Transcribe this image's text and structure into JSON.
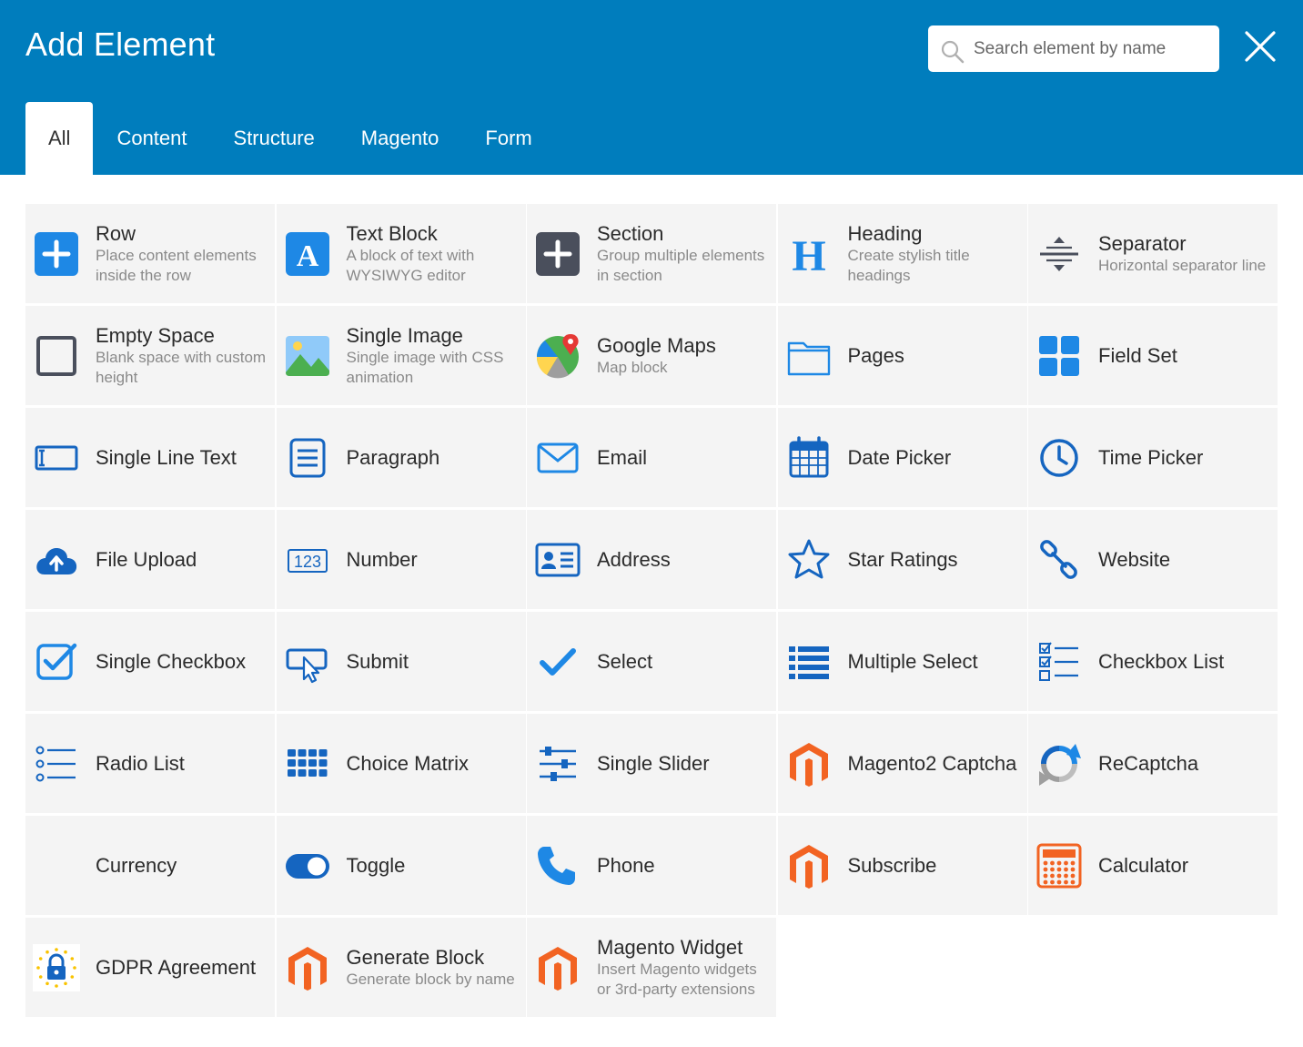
{
  "header": {
    "title": "Add Element",
    "search_placeholder": "Search element by name",
    "close_icon": "close-icon",
    "background": "#007dbd"
  },
  "tabs": [
    {
      "label": "All",
      "active": true
    },
    {
      "label": "Content",
      "active": false
    },
    {
      "label": "Structure",
      "active": false
    },
    {
      "label": "Magento",
      "active": false
    },
    {
      "label": "Form",
      "active": false
    }
  ],
  "elements": [
    {
      "id": "row",
      "name": "Row",
      "desc": "Place content elements inside the row",
      "icon": "plus-square-icon"
    },
    {
      "id": "text-block",
      "name": "Text Block",
      "desc": "A block of text with WYSIWYG editor",
      "icon": "letter-a-icon"
    },
    {
      "id": "section",
      "name": "Section",
      "desc": "Group multiple elements in section",
      "icon": "plus-square-dark-icon"
    },
    {
      "id": "heading",
      "name": "Heading",
      "desc": "Create stylish title headings",
      "icon": "letter-h-icon"
    },
    {
      "id": "separator",
      "name": "Separator",
      "desc": "Horizontal separator line",
      "icon": "separator-icon"
    },
    {
      "id": "empty-space",
      "name": "Empty Space",
      "desc": "Blank space with custom height",
      "icon": "empty-square-icon"
    },
    {
      "id": "single-image",
      "name": "Single Image",
      "desc": "Single image with CSS animation",
      "icon": "image-icon"
    },
    {
      "id": "google-maps",
      "name": "Google Maps",
      "desc": "Map block",
      "icon": "google-maps-icon"
    },
    {
      "id": "pages",
      "name": "Pages",
      "desc": "",
      "icon": "folder-icon"
    },
    {
      "id": "field-set",
      "name": "Field Set",
      "desc": "",
      "icon": "grid-2x2-icon"
    },
    {
      "id": "single-line-text",
      "name": "Single Line Text",
      "desc": "",
      "icon": "text-input-icon"
    },
    {
      "id": "paragraph",
      "name": "Paragraph",
      "desc": "",
      "icon": "paragraph-icon"
    },
    {
      "id": "email",
      "name": "Email",
      "desc": "",
      "icon": "envelope-icon"
    },
    {
      "id": "date-picker",
      "name": "Date Picker",
      "desc": "",
      "icon": "calendar-icon"
    },
    {
      "id": "time-picker",
      "name": "Time Picker",
      "desc": "",
      "icon": "clock-icon"
    },
    {
      "id": "file-upload",
      "name": "File Upload",
      "desc": "",
      "icon": "cloud-upload-icon"
    },
    {
      "id": "number",
      "name": "Number",
      "desc": "",
      "icon": "number-123-icon",
      "icon_text": "123"
    },
    {
      "id": "address",
      "name": "Address",
      "desc": "",
      "icon": "address-card-icon"
    },
    {
      "id": "star-ratings",
      "name": "Star Ratings",
      "desc": "",
      "icon": "star-icon"
    },
    {
      "id": "website",
      "name": "Website",
      "desc": "",
      "icon": "link-icon"
    },
    {
      "id": "single-checkbox",
      "name": "Single Checkbox",
      "desc": "",
      "icon": "checkbox-icon"
    },
    {
      "id": "submit",
      "name": "Submit",
      "desc": "",
      "icon": "submit-pointer-icon"
    },
    {
      "id": "select",
      "name": "Select",
      "desc": "",
      "icon": "checkmark-icon"
    },
    {
      "id": "multiple-select",
      "name": "Multiple Select",
      "desc": "",
      "icon": "list-icon"
    },
    {
      "id": "checkbox-list",
      "name": "Checkbox List",
      "desc": "",
      "icon": "checkbox-list-icon"
    },
    {
      "id": "radio-list",
      "name": "Radio List",
      "desc": "",
      "icon": "radio-list-icon"
    },
    {
      "id": "choice-matrix",
      "name": "Choice Matrix",
      "desc": "",
      "icon": "matrix-icon"
    },
    {
      "id": "single-slider",
      "name": "Single Slider",
      "desc": "",
      "icon": "sliders-icon"
    },
    {
      "id": "magento2-captcha",
      "name": "Magento2 Captcha",
      "desc": "",
      "icon": "magento-icon"
    },
    {
      "id": "recaptcha",
      "name": "ReCaptcha",
      "desc": "",
      "icon": "recaptcha-icon"
    },
    {
      "id": "currency",
      "name": "Currency",
      "desc": "",
      "icon": ""
    },
    {
      "id": "toggle",
      "name": "Toggle",
      "desc": "",
      "icon": "toggle-icon"
    },
    {
      "id": "phone",
      "name": "Phone",
      "desc": "",
      "icon": "phone-icon"
    },
    {
      "id": "subscribe",
      "name": "Subscribe",
      "desc": "",
      "icon": "magento-icon"
    },
    {
      "id": "calculator",
      "name": "Calculator",
      "desc": "",
      "icon": "calculator-icon"
    },
    {
      "id": "gdpr-agreement",
      "name": "GDPR Agreement",
      "desc": "",
      "icon": "gdpr-lock-icon"
    },
    {
      "id": "generate-block",
      "name": "Generate Block",
      "desc": "Generate block by name",
      "icon": "magento-icon"
    },
    {
      "id": "magento-widget",
      "name": "Magento Widget",
      "desc": "Insert Magento widgets or 3rd-party extensions",
      "icon": "magento-icon"
    }
  ],
  "colors": {
    "blue": "#1e88e5",
    "dark_blue": "#1565c0",
    "dark_gray": "#4a4f5c",
    "magento_orange": "#f26322",
    "card_bg": "#f4f4f4"
  }
}
